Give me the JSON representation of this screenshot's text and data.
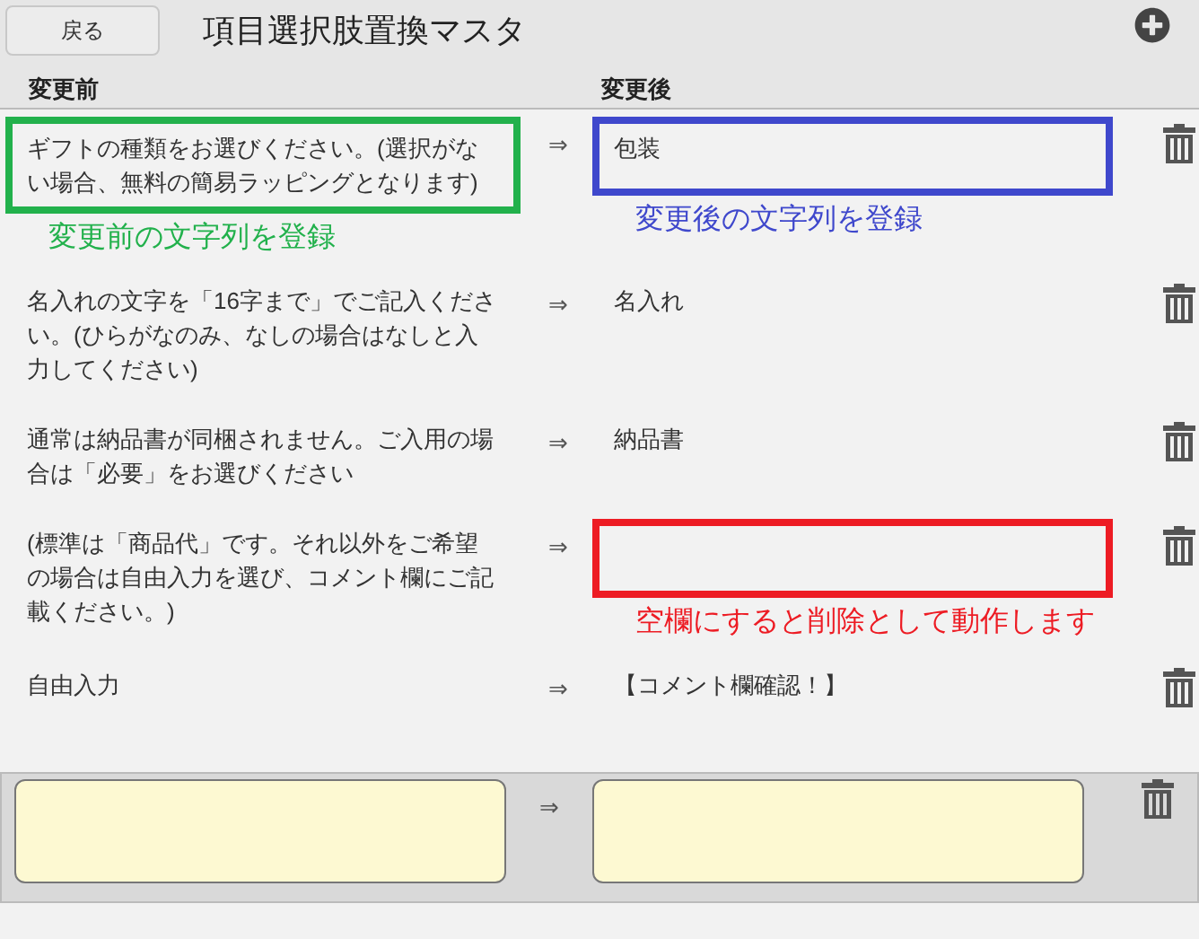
{
  "header": {
    "back_button": "戻る",
    "title": "項目選択肢置換マスタ"
  },
  "columns": {
    "before": "変更前",
    "after": "変更後"
  },
  "rows": [
    {
      "before": "ギフトの種類をお選びください。(選択がない場合、無料の簡易ラッピングとなります)",
      "arrow": "⇒",
      "after": "包装",
      "before_note": {
        "color": "#22b14c",
        "label": "変更前の文字列を登録"
      },
      "after_note": {
        "color": "#3f48cc",
        "label": "変更後の文字列を登録"
      }
    },
    {
      "before": "名入れの文字を「16字まで」でご記入ください。(ひらがなのみ、なしの場合はなしと入力してください)",
      "arrow": "⇒",
      "after": "名入れ"
    },
    {
      "before": "通常は納品書が同梱されません。ご入用の場合は「必要」をお選びください",
      "arrow": "⇒",
      "after": "納品書"
    },
    {
      "before": "(標準は「商品代」です。それ以外をご希望の場合は自由入力を選び、コメント欄にご記載ください。)",
      "arrow": "⇒",
      "after": "",
      "after_note": {
        "color": "#ed1c24",
        "label": "空欄にすると削除として動作します"
      }
    },
    {
      "before": "自由入力",
      "arrow": "⇒",
      "after": "【コメント欄確認！】"
    }
  ],
  "new_row": {
    "arrow": "⇒"
  }
}
